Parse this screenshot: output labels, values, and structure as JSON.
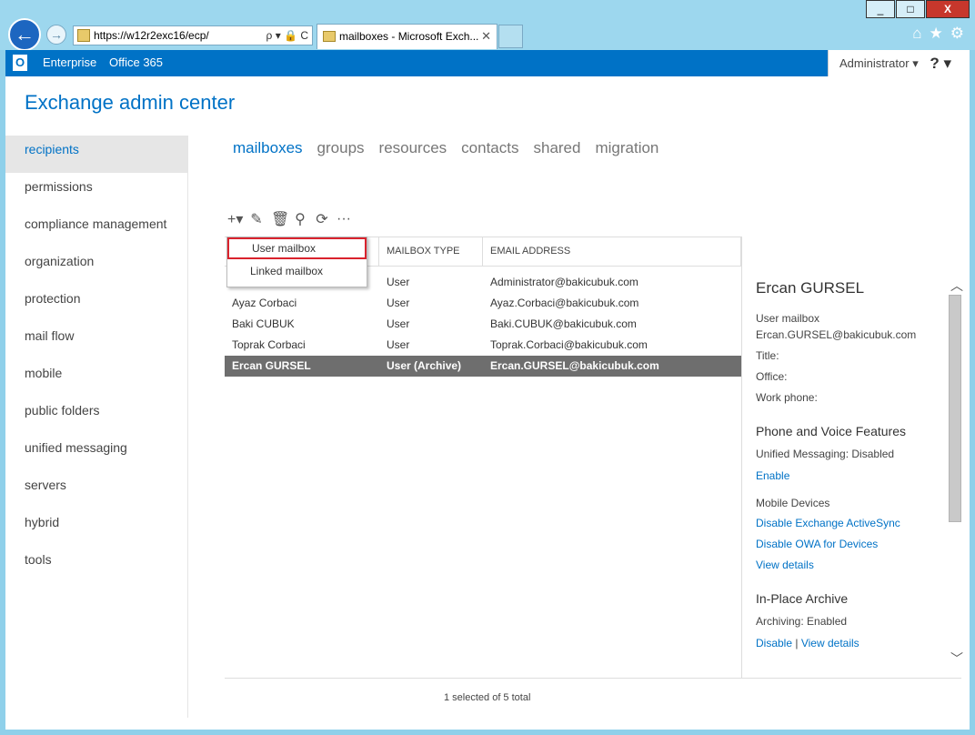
{
  "browser": {
    "address": "https://w12r2exc16/ecp/",
    "tab_title": "mailboxes - Microsoft Exch...",
    "tab_close": "✕",
    "win_min": "_",
    "win_max": "□",
    "win_close": "X",
    "addr_tools": "ρ ▾ 🔒 C"
  },
  "o365bar": {
    "logo": "O",
    "link1": "Enterprise",
    "link2": "Office 365",
    "user": "Administrator ▾",
    "help": "? ▾"
  },
  "app": {
    "title": "Exchange admin center"
  },
  "leftnav": [
    {
      "label": "recipients",
      "active": true
    },
    {
      "label": "permissions"
    },
    {
      "label": "compliance management"
    },
    {
      "label": "organization"
    },
    {
      "label": "protection"
    },
    {
      "label": "mail flow"
    },
    {
      "label": "mobile"
    },
    {
      "label": "public folders"
    },
    {
      "label": "unified messaging"
    },
    {
      "label": "servers"
    },
    {
      "label": "hybrid"
    },
    {
      "label": "tools"
    }
  ],
  "tabs": [
    "mailboxes",
    "groups",
    "resources",
    "contacts",
    "shared",
    "migration"
  ],
  "grid": {
    "headers": [
      "",
      "MAILBOX TYPE",
      "EMAIL ADDRESS"
    ],
    "rows": [
      {
        "name": "",
        "type": "User",
        "email": "Administrator@bakicubuk.com"
      },
      {
        "name": "Ayaz Corbaci",
        "type": "User",
        "email": "Ayaz.Corbaci@bakicubuk.com"
      },
      {
        "name": "Baki CUBUK",
        "type": "User",
        "email": "Baki.CUBUK@bakicubuk.com"
      },
      {
        "name": "Toprak Corbaci",
        "type": "User",
        "email": "Toprak.Corbaci@bakicubuk.com"
      },
      {
        "name": "Ercan GURSEL",
        "type": "User (Archive)",
        "email": "Ercan.GURSEL@bakicubuk.com"
      }
    ],
    "status": "1 selected of 5 total"
  },
  "dropdown": [
    "User mailbox",
    "Linked mailbox"
  ],
  "details": {
    "name": "Ercan GURSEL",
    "type": "User mailbox",
    "email": "Ercan.GURSEL@bakicubuk.com",
    "title_label": "Title:",
    "office_label": "Office:",
    "phone_label": "Work phone:",
    "pv_header": "Phone and Voice Features",
    "um_label": "Unified Messaging:  Disabled",
    "um_enable": "Enable",
    "mobile_header": "Mobile Devices",
    "disable_eas": "Disable Exchange ActiveSync",
    "disable_owa": "Disable OWA for Devices",
    "view_details": "View details",
    "archive_header": "In-Place Archive",
    "archiving_label": "Archiving:  Enabled",
    "archive_disable": "Disable",
    "archive_sep": "|",
    "archive_view": "View details"
  }
}
